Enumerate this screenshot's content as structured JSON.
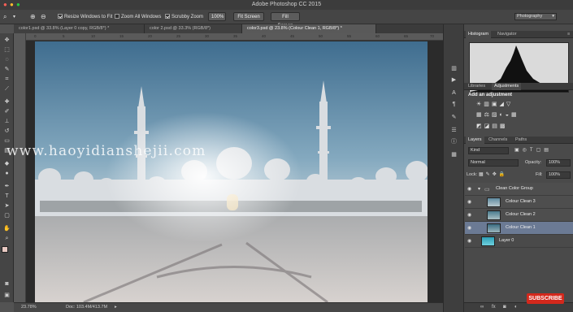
{
  "window": {
    "title": "Adobe Photoshop CC 2015"
  },
  "options_bar": {
    "resize_windows_label": "Resize Windows to Fit",
    "zoom_all_windows_label": "Zoom All Windows",
    "scrubby_zoom_label": "Scrubby Zoom",
    "zoom_100_label": "100%",
    "fit_screen_label": "Fit Screen",
    "fill_screen_label": "Fill Screen",
    "workspace": "Photography"
  },
  "doc_tabs": [
    {
      "label": "color1.psd @ 33.8% (Layer 0 copy, RGB/8*) *"
    },
    {
      "label": "color 2.psd @ 33.3% (RGB/8*)"
    },
    {
      "label": "color3.psd @ 23.8% (Colour Clean 1, RGB/8*) *"
    }
  ],
  "ruler_marks": [
    "0",
    "5",
    "10",
    "15",
    "20",
    "25",
    "30",
    "35",
    "40",
    "45",
    "50",
    "55",
    "60",
    "65",
    "70"
  ],
  "status": {
    "zoom": "23.78%",
    "doc": "Doc: 103.4M/413.7M"
  },
  "panels": {
    "histogram_tab": "Histogram",
    "navigator_tab": "Navigator",
    "libraries_tab": "Libraries",
    "adjustments_tab": "Adjustments",
    "add_adjustment": "Add an adjustment",
    "layers_tab": "Layers",
    "channels_tab": "Channels",
    "paths_tab": "Paths",
    "kind_filter": "Kind",
    "blend_mode": "Normal",
    "opacity_label": "Opacity:",
    "opacity_value": "100%",
    "lock_label": "Lock:",
    "fill_label": "Fill:",
    "fill_value": "100%"
  },
  "layers": [
    {
      "name": "Clean Color Group"
    },
    {
      "name": "Colour Clean 3"
    },
    {
      "name": "Colour Clean 2"
    },
    {
      "name": "Colour Clean 1"
    },
    {
      "name": "Layer 0"
    }
  ],
  "watermark": "www.haoyidianshejii.com",
  "subscribe": "SUBSCRIBE",
  "colors": {
    "selected_layer": "#6b7a94",
    "subscribe": "#d4281c",
    "panel_bg": "#4a4a4a"
  }
}
